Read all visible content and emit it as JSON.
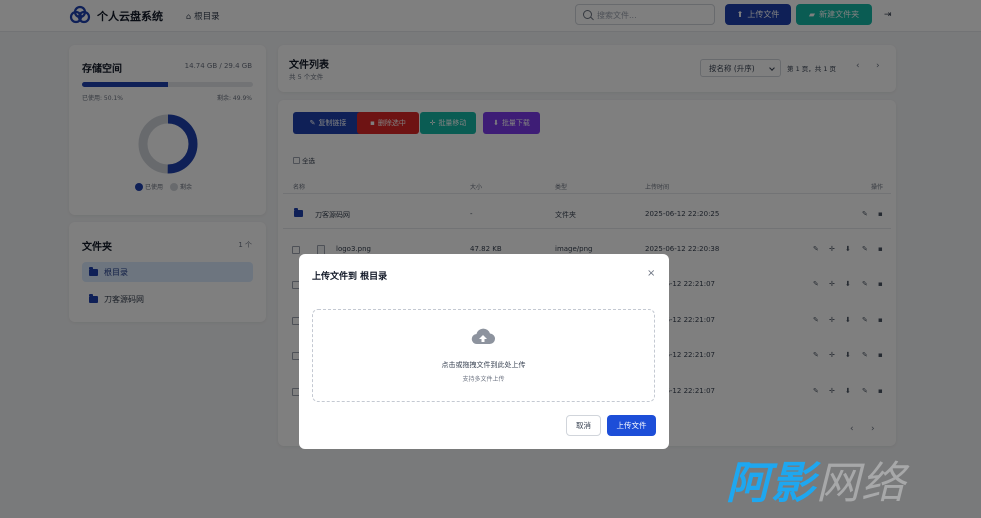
{
  "header": {
    "brand": "个人云盘系统",
    "breadcrumb": "根目录",
    "search_placeholder": "搜索文件...",
    "upload_label": "上传文件",
    "new_folder_label": "新建文件夹",
    "colors": {
      "primary": "#1e40af",
      "teal": "#14b8a6"
    }
  },
  "storage": {
    "title": "存储空间",
    "usage": "14.74 GB / 29.4 GB",
    "used_fraction": 0.501,
    "used_label": "已使用: 50.1%",
    "free_label": "剩余: 49.9%",
    "legend_used": "已使用",
    "legend_free": "剩余"
  },
  "folders": {
    "title": "文件夹",
    "count": "1 个",
    "items": [
      {
        "label": "根目录",
        "active": true
      },
      {
        "label": "刀客源码网",
        "active": false
      }
    ]
  },
  "file_list": {
    "title": "文件列表",
    "subtitle": "共 5 个文件",
    "sort_value": "按名称 (升序)",
    "page_info": "第 1 页，共 1 页",
    "actions": {
      "copy_link": "复制链接",
      "delete_selected": "删除选中",
      "batch_move": "批量移动",
      "batch_download": "批量下载"
    },
    "select_all": "全选",
    "columns": {
      "name": "名称",
      "size": "大小",
      "type": "类型",
      "upload_time": "上传时间",
      "actions": "操作"
    },
    "rows": [
      {
        "name": "刀客源码网",
        "size": "-",
        "type": "文件夹",
        "time": "2025-06-12 22:20:25"
      },
      {
        "name": "logo3.png",
        "size": "47.82 KB",
        "type": "image/png",
        "time": "2025-06-12 22:20:38"
      },
      {
        "time": "06-12 22:21:07"
      },
      {
        "time": "06-12 22:21:07"
      },
      {
        "time": "06-12 22:21:07"
      },
      {
        "time": "06-12 22:21:07"
      }
    ]
  },
  "modal": {
    "title": "上传文件到 根目录",
    "dropzone_text": "点击或拖拽文件到此处上传",
    "dropzone_hint": "支持多文件上传",
    "cancel_label": "取消",
    "confirm_label": "上传文件"
  },
  "watermark": {
    "text": "阿影",
    "suffix": "网络"
  }
}
